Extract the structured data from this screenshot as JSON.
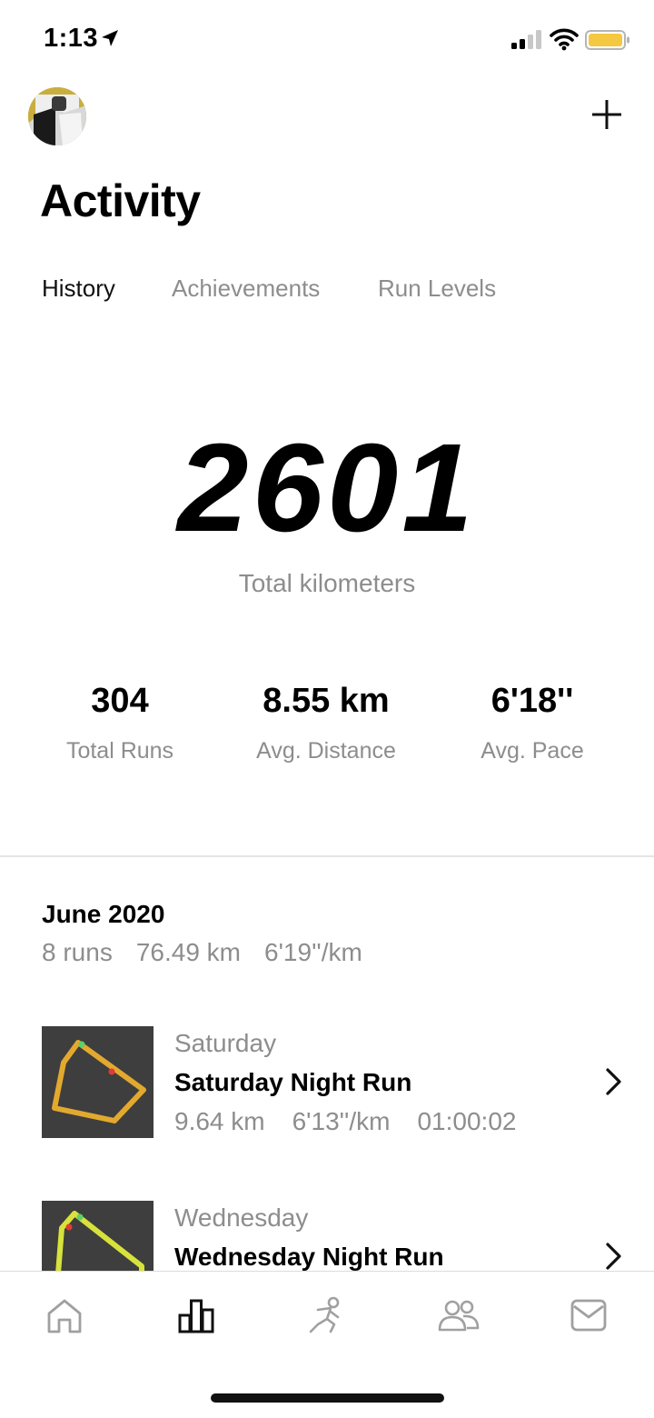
{
  "status_bar": {
    "time": "1:13",
    "battery_color": "#f5c842"
  },
  "header": {
    "avatar_icon": "profile-avatar",
    "add_icon": "plus-icon"
  },
  "page_title": "Activity",
  "tabs": [
    {
      "label": "History",
      "active": true
    },
    {
      "label": "Achievements",
      "active": false
    },
    {
      "label": "Run Levels",
      "active": false
    }
  ],
  "total": {
    "value": "2601",
    "label": "Total kilometers"
  },
  "stats": [
    {
      "value": "304",
      "label": "Total Runs"
    },
    {
      "value": "8.55 km",
      "label": "Avg. Distance"
    },
    {
      "value": "6'18''",
      "label": "Avg. Pace"
    }
  ],
  "month": {
    "title": "June 2020",
    "runs": "8 runs",
    "distance": "76.49 km",
    "pace": "6'19''/km"
  },
  "runs": [
    {
      "day": "Saturday",
      "name": "Saturday Night Run",
      "distance": "9.64 km",
      "pace": "6'13''/km",
      "duration": "01:00:02",
      "route_color": "#e3a92e"
    },
    {
      "day": "Wednesday",
      "name": "Wednesday Night Run",
      "route_color": "#d7e23b"
    }
  ],
  "nav": [
    {
      "icon": "home-icon",
      "active": false
    },
    {
      "icon": "activity-chart-icon",
      "active": true
    },
    {
      "icon": "runner-icon",
      "active": false
    },
    {
      "icon": "friends-icon",
      "active": false
    },
    {
      "icon": "inbox-icon",
      "active": false
    }
  ]
}
